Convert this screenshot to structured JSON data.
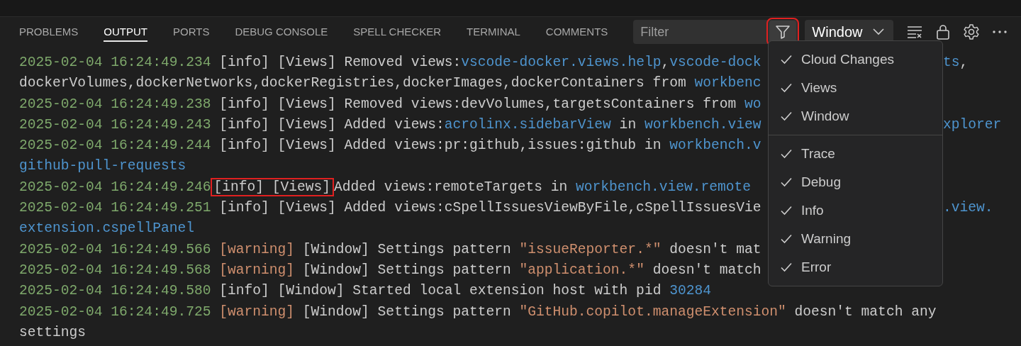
{
  "tabs": [
    {
      "label": "PROBLEMS",
      "selected": false
    },
    {
      "label": "OUTPUT",
      "selected": true
    },
    {
      "label": "PORTS",
      "selected": false
    },
    {
      "label": "DEBUG CONSOLE",
      "selected": false
    },
    {
      "label": "SPELL CHECKER",
      "selected": false
    },
    {
      "label": "TERMINAL",
      "selected": false
    },
    {
      "label": "COMMENTS",
      "selected": false
    }
  ],
  "filter": {
    "placeholder": "Filter",
    "button_highlighted": true
  },
  "channel_select": {
    "value": "Window"
  },
  "log_lines": [
    {
      "segments": [
        {
          "kind": "timestamp",
          "text": "2025-02-04 16:24:49.234 "
        },
        {
          "kind": "info",
          "text": "[info]"
        },
        {
          "kind": "plain",
          "text": " [Views] Removed views:"
        },
        {
          "kind": "link",
          "text": "vscode-docker.views.help"
        },
        {
          "kind": "plain",
          "text": ","
        },
        {
          "kind": "link",
          "text": "vscode-dock"
        }
      ],
      "tail": [
        {
          "kind": "link",
          "text": "ts"
        },
        {
          "kind": "plain",
          "text": ","
        }
      ]
    },
    {
      "segments": [
        {
          "kind": "plain",
          "text": "dockerVolumes,dockerNetworks,dockerRegistries,dockerImages,dockerContainers from "
        },
        {
          "kind": "link",
          "text": "workbenc"
        }
      ]
    },
    {
      "segments": [
        {
          "kind": "timestamp",
          "text": "2025-02-04 16:24:49.238 "
        },
        {
          "kind": "info",
          "text": "[info]"
        },
        {
          "kind": "plain",
          "text": " [Views] Removed views:devVolumes,targetsContainers from "
        },
        {
          "kind": "link",
          "text": "wo"
        }
      ]
    },
    {
      "segments": [
        {
          "kind": "timestamp",
          "text": "2025-02-04 16:24:49.243 "
        },
        {
          "kind": "info",
          "text": "[info]"
        },
        {
          "kind": "plain",
          "text": " [Views] Added views:"
        },
        {
          "kind": "link",
          "text": "acrolinx.sidebarView"
        },
        {
          "kind": "plain",
          "text": " in "
        },
        {
          "kind": "link",
          "text": "workbench.view"
        }
      ],
      "tail": [
        {
          "kind": "link",
          "text": "xplorer"
        }
      ]
    },
    {
      "segments": [
        {
          "kind": "timestamp",
          "text": "2025-02-04 16:24:49.244 "
        },
        {
          "kind": "info",
          "text": "[info]"
        },
        {
          "kind": "plain",
          "text": " [Views] Added views:pr:github,issues:github in "
        },
        {
          "kind": "link",
          "text": "workbench.v"
        }
      ]
    },
    {
      "segments": [
        {
          "kind": "link",
          "text": "github-pull-requests"
        }
      ]
    },
    {
      "segments": [
        {
          "kind": "timestamp",
          "text": "2025-02-04 16:24:49.246"
        },
        {
          "kind": "info",
          "text": "[info] [Views]",
          "highlighted": true
        },
        {
          "kind": "plain",
          "text": "Added views:remoteTargets in "
        },
        {
          "kind": "link",
          "text": "workbench.view.remote"
        }
      ]
    },
    {
      "segments": [
        {
          "kind": "timestamp",
          "text": "2025-02-04 16:24:49.251 "
        },
        {
          "kind": "info",
          "text": "[info]"
        },
        {
          "kind": "plain",
          "text": " [Views] Added views:cSpellIssuesViewByFile,cSpellIssuesVie"
        }
      ],
      "tail": [
        {
          "kind": "link",
          "text": ".view."
        }
      ]
    },
    {
      "segments": [
        {
          "kind": "link",
          "text": "extension.cspellPanel"
        }
      ]
    },
    {
      "segments": [
        {
          "kind": "timestamp",
          "text": "2025-02-04 16:24:49.566 "
        },
        {
          "kind": "warning",
          "text": "[warning]"
        },
        {
          "kind": "plain",
          "text": " [Window] Settings pattern "
        },
        {
          "kind": "string",
          "text": "\"issueReporter.*\""
        },
        {
          "kind": "plain",
          "text": " doesn't mat"
        }
      ]
    },
    {
      "segments": [
        {
          "kind": "timestamp",
          "text": "2025-02-04 16:24:49.568 "
        },
        {
          "kind": "warning",
          "text": "[warning]"
        },
        {
          "kind": "plain",
          "text": " [Window] Settings pattern "
        },
        {
          "kind": "string",
          "text": "\"application.*\""
        },
        {
          "kind": "plain",
          "text": " doesn't match"
        }
      ]
    },
    {
      "segments": [
        {
          "kind": "timestamp",
          "text": "2025-02-04 16:24:49.580 "
        },
        {
          "kind": "info",
          "text": "[info]"
        },
        {
          "kind": "plain",
          "text": " [Window] Started local extension host with pid "
        },
        {
          "kind": "link",
          "text": "30284"
        }
      ]
    },
    {
      "segments": [
        {
          "kind": "timestamp",
          "text": "2025-02-04 16:24:49.725 "
        },
        {
          "kind": "warning",
          "text": "[warning]"
        },
        {
          "kind": "plain",
          "text": " [Window] Settings pattern "
        },
        {
          "kind": "string",
          "text": "\"GitHub.copilot.manageExtension\""
        },
        {
          "kind": "plain",
          "text": " doesn't match any"
        }
      ]
    },
    {
      "segments": [
        {
          "kind": "plain",
          "text": "settings"
        }
      ]
    }
  ],
  "filter_menu": {
    "groups": [
      [
        {
          "label": "Cloud Changes",
          "checked": true
        },
        {
          "label": "Views",
          "checked": true
        },
        {
          "label": "Window",
          "checked": true
        }
      ],
      [
        {
          "label": "Trace",
          "checked": true
        },
        {
          "label": "Debug",
          "checked": true
        },
        {
          "label": "Info",
          "checked": true
        },
        {
          "label": "Warning",
          "checked": true
        },
        {
          "label": "Error",
          "checked": true
        }
      ]
    ]
  }
}
